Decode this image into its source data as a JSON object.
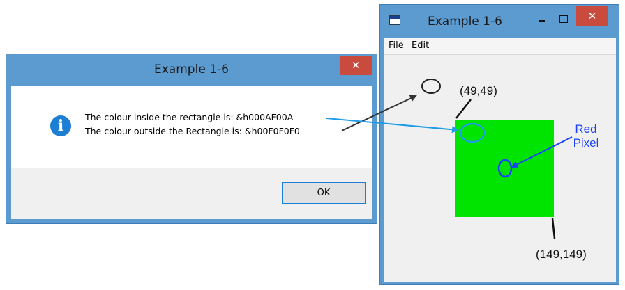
{
  "right_window": {
    "title": "Example 1-6",
    "close_glyph": "✕",
    "menu": [
      "File",
      "Edit"
    ],
    "rect_color": "#00e400"
  },
  "dialog": {
    "title": "Example 1-6",
    "close_glyph": "✕",
    "icon_glyph": "i",
    "message_line1": "The colour inside the rectangle is: &h000AF00A",
    "message_line2": "The colour outside the Rectangle is: &h00F0F0F0",
    "ok_label": "OK"
  },
  "annotations": {
    "top_left_coord": "(49,49)",
    "bottom_right_coord": "(149,149)",
    "red_pixel_line1": "Red",
    "red_pixel_line2": "Pixel"
  },
  "colors": {
    "window_frame": "#5b9bd0",
    "close_button": "#c84b3d",
    "info_icon": "#1d7fd3",
    "arrow_light_blue": "#1e9ce8",
    "arrow_dark": "#333333",
    "red_pixel_label": "#1a3fff"
  }
}
